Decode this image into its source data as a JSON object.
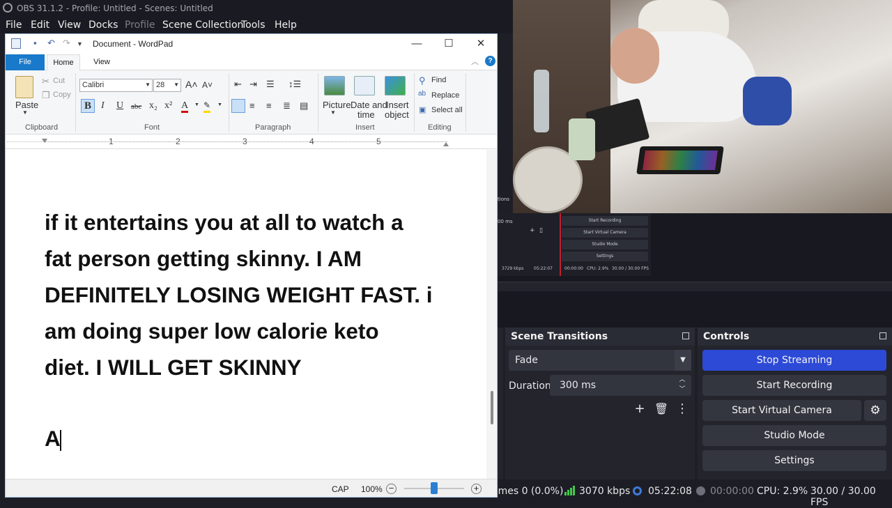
{
  "obs": {
    "title": "OBS 31.1.2 - Profile: Untitled - Scenes: Untitled",
    "menu": [
      "File",
      "Edit",
      "View",
      "Docks",
      "Profile",
      "Scene Collection",
      "Tools",
      "Help"
    ],
    "mini_panel": {
      "buttons": [
        "Start Recording",
        "Start Virtual Camera",
        "Studio Mode",
        "Settings"
      ],
      "cut_label": "tions",
      "duration_fragment": "00 ms",
      "status": {
        "kbps": "3729 kbps",
        "time": "05:22:07",
        "rec": "00:00:00",
        "cpu": "CPU: 2.9%",
        "fps": "30.00 / 30.00 FPS"
      }
    },
    "scene_transitions": {
      "title": "Scene Transitions",
      "transition": "Fade",
      "duration_label": "Duration",
      "duration_value": "300 ms"
    },
    "controls": {
      "title": "Controls",
      "stop_streaming": "Stop Streaming",
      "start_recording": "Start Recording",
      "start_virtual_camera": "Start Virtual Camera",
      "studio_mode": "Studio Mode",
      "settings": "Settings"
    },
    "status_bar": {
      "dropped_frames": "ames 0 (0.0%)",
      "bitrate": "3070 kbps",
      "stream_time": "05:22:08",
      "rec_time": "00:00:00",
      "cpu": "CPU: 2.9%",
      "fps": "30.00 / 30.00 FPS"
    },
    "colors": {
      "accent": "#2d4ad6",
      "background": "#1e1f26",
      "panel": "#23242c",
      "live": "#3e7ad8",
      "network_ok": "#40c84a"
    }
  },
  "wordpad": {
    "title": "Document - WordPad",
    "tabs": {
      "file": "File",
      "home": "Home",
      "view": "View"
    },
    "ribbon": {
      "clipboard": {
        "label": "Clipboard",
        "paste": "Paste",
        "cut": "Cut",
        "copy": "Copy"
      },
      "font": {
        "label": "Font",
        "family": "Calibri",
        "size": "28"
      },
      "paragraph": {
        "label": "Paragraph"
      },
      "insert": {
        "label": "Insert",
        "picture": "Picture",
        "date_time_1": "Date and",
        "date_time_2": "time",
        "object_1": "Insert",
        "object_2": "object"
      },
      "editing": {
        "label": "Editing",
        "find": "Find",
        "replace": "Replace",
        "select_all": "Select all"
      }
    },
    "ruler": [
      "1",
      "2",
      "3",
      "4",
      "5"
    ],
    "document": {
      "lines": [
        "if it entertains you at all to watch a",
        "fat person getting skinny. I AM",
        "DEFINITELY LOSING WEIGHT FAST. i",
        "am doing super low calorie keto",
        "diet. I WILL GET SKINNY"
      ],
      "last_line": "A"
    },
    "status": {
      "caps": "CAP",
      "zoom": "100%",
      "zoom_level": 0.5
    }
  }
}
